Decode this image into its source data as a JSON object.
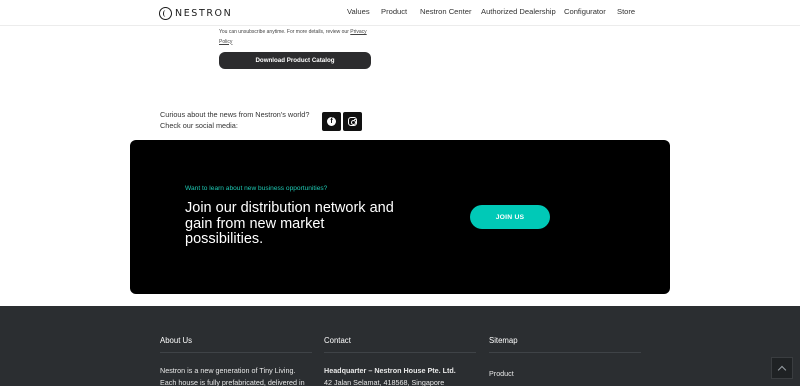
{
  "header": {
    "logo_text": "NESTRON",
    "nav": [
      {
        "label": "Values"
      },
      {
        "label": "Product"
      },
      {
        "label": "Nestron Center"
      },
      {
        "label": "Authorized Dealership"
      },
      {
        "label": "Configurator"
      },
      {
        "label": "Store"
      }
    ]
  },
  "newsletter": {
    "unsubscribe_text": "You can unsubscribe anytime. For more details, review our",
    "privacy_link": "Privacy Policy",
    "catalog_button": "Download Product Catalog"
  },
  "social": {
    "text_line1": "Curious about the news from Nestron's world?",
    "text_line2": "Check our social media:",
    "facebook_glyph": "f",
    "icons": [
      "facebook-icon",
      "instagram-icon"
    ]
  },
  "banner": {
    "eyebrow": "Want to learn about new business opportunities?",
    "heading": "Join our distribution network and gain from new market possibilities.",
    "button": "JOIN US",
    "accent_color": "#00c9b7"
  },
  "footer": {
    "about": {
      "title": "About Us",
      "line1": "Nestron is a new generation of Tiny Living.",
      "line2": "Each house is fully prefabricated, delivered in"
    },
    "contact": {
      "title": "Contact",
      "line1": "Headquarter – Nestron House Pte. Ltd.",
      "line2": "42 Jalan Selamat, 418568, Singapore"
    },
    "sitemap": {
      "title": "Sitemap",
      "line1": "Product"
    }
  }
}
